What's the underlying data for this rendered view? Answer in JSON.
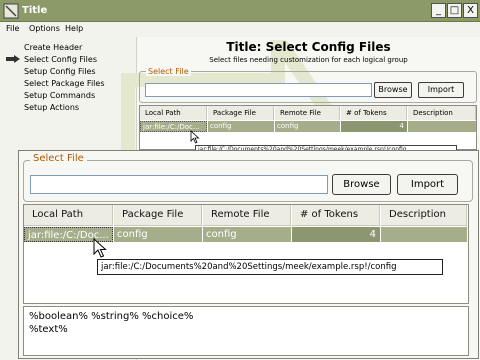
{
  "window": {
    "title": "Title",
    "controls": {
      "minimize": "_",
      "maximize": "□",
      "close": "X"
    }
  },
  "menu": [
    "File",
    "Options",
    "Help"
  ],
  "sidebar": {
    "items": [
      "Create Header",
      "Select Config Files",
      "Setup Config Files",
      "Select Package Files",
      "Setup Commands",
      "Setup Actions"
    ],
    "current_index": 1
  },
  "page": {
    "title": "Title: Select Config Files",
    "subtitle": "Select files needing customization for each logical group"
  },
  "select_file": {
    "legend": "Select File",
    "input_value": "",
    "browse_label": "Browse",
    "import_label": "Import"
  },
  "table": {
    "columns": [
      "Local Path",
      "Package File",
      "Remote File",
      "# of Tokens",
      "Description"
    ],
    "rows": [
      {
        "local_path": "jar:file:/C:/Doc...",
        "package_file": "config",
        "remote_file": "config",
        "tokens": "4",
        "description": ""
      }
    ],
    "bg_local_path": "jar:file:/C:/Doc...",
    "tooltip": "jar:file:/C:/Documents%20and%20Settings/meek/example.rsp!/config",
    "bg_tooltip": "jar:file:/C:/Documents%20and%20Settings/meek/example.rsp!/config"
  },
  "tokens_text": [
    "%boolean% %string% %choice%",
    "%text%"
  ],
  "colors": {
    "accent": "#8b9a68",
    "selection": "#a5ad8a",
    "legend": "#b35a00"
  }
}
